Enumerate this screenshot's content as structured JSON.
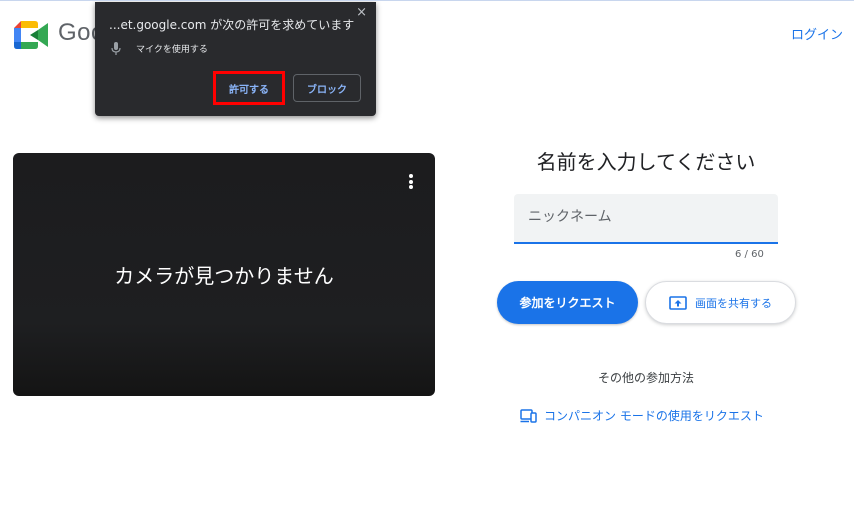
{
  "header": {
    "logo_text": "Goo",
    "login_label": "ログイン"
  },
  "permission_popup": {
    "title": "...et.google.com が次の許可を求めています",
    "close_glyph": "×",
    "permission_item": "マイクを使用する",
    "allow_label": "許可する",
    "block_label": "ブロック"
  },
  "camera": {
    "message": "カメラが見つかりません"
  },
  "join_panel": {
    "heading": "名前を入力してください",
    "name_field": {
      "placeholder": "ニックネーム",
      "value": ""
    },
    "char_count": "6 / 60",
    "join_button_label": "参加をリクエスト",
    "share_button_label": "画面を共有する",
    "other_methods_label": "その他の参加方法",
    "companion_link_label": "コンパニオン モードの使用をリクエスト"
  },
  "colors": {
    "accent": "#1a73e8",
    "popup_bg": "#292a2d",
    "popup_link": "#8ab4f8",
    "highlight": "#ff0000",
    "camera_bg": "#1e1f21"
  }
}
